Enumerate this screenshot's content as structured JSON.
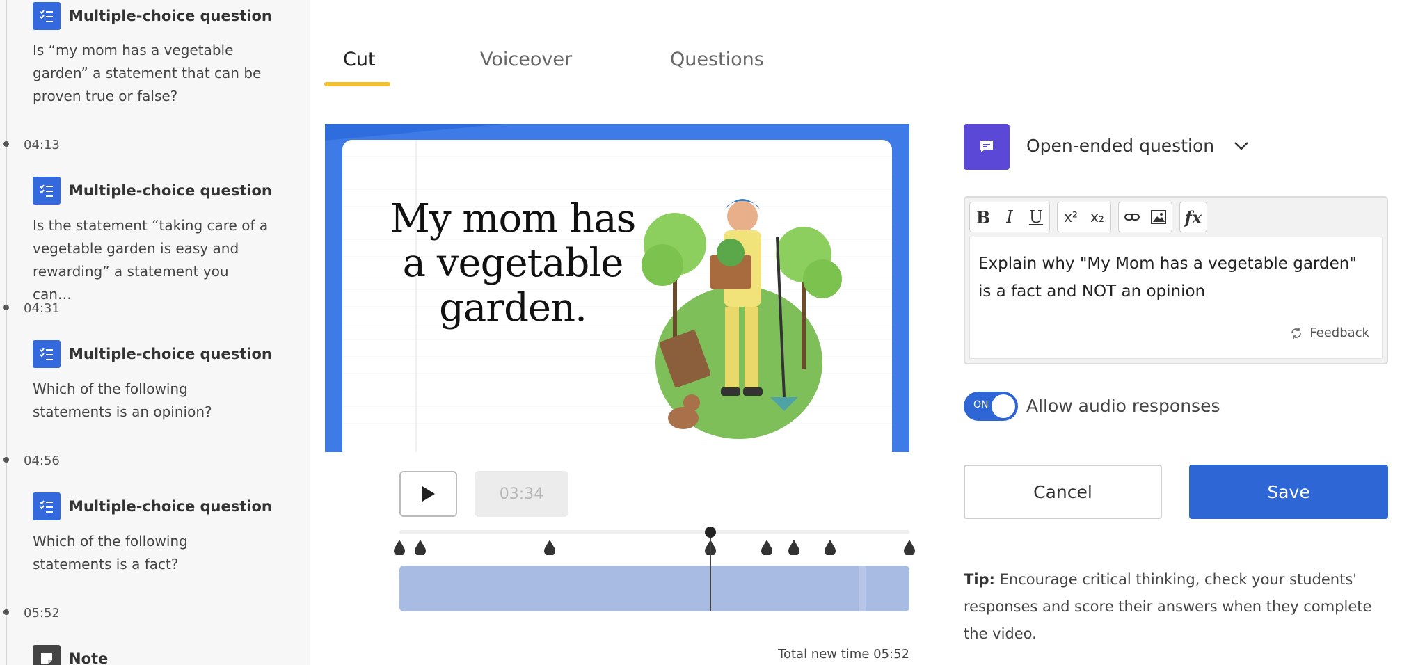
{
  "sidebar": {
    "items": [
      {
        "time": "",
        "type": "Multiple-choice question",
        "text": "Is “my mom has a vegetable garden” a statement that can be proven true or false?"
      },
      {
        "time": "04:13",
        "type": "Multiple-choice question",
        "text": "Is the statement “taking care of a vegetable garden is easy and rewarding” a statement you can…"
      },
      {
        "time": "04:31",
        "type": "Multiple-choice question",
        "text": "Which of the following statements is an opinion?"
      },
      {
        "time": "04:56",
        "type": "Multiple-choice question",
        "text": "Which of the following statements is a fact?"
      },
      {
        "time": "05:52",
        "type": "Note",
        "text": ""
      }
    ]
  },
  "tabs": [
    {
      "label": "Cut",
      "active": true
    },
    {
      "label": "Voiceover",
      "active": false
    },
    {
      "label": "Questions",
      "active": false
    }
  ],
  "video": {
    "slide_text": "My mom has a vegetable garden."
  },
  "player": {
    "current_time": "03:34",
    "total_label": "Total new time 05:52"
  },
  "question": {
    "type_label": "Open-ended question",
    "body": "Explain why \"My Mom has a vegetable garden\" is a fact and NOT an opinion",
    "feedback_label": "Feedback",
    "toolbar": [
      "bold",
      "italic",
      "underline",
      "superscript",
      "subscript",
      "link",
      "image",
      "formula"
    ]
  },
  "audio_toggle": {
    "state_label": "ON",
    "label": "Allow audio responses",
    "on": true
  },
  "actions": {
    "cancel": "Cancel",
    "save": "Save"
  },
  "tip": {
    "prefix": "Tip:",
    "text": " Encourage critical thinking, check your students' responses and score their answers when they complete the video."
  },
  "colors": {
    "accent_blue": "#2f66d6",
    "question_icon": "#3468dd",
    "open_ended_icon": "#5b48d6",
    "tab_underline": "#f3c033",
    "timeline": "#a8bbe3"
  }
}
